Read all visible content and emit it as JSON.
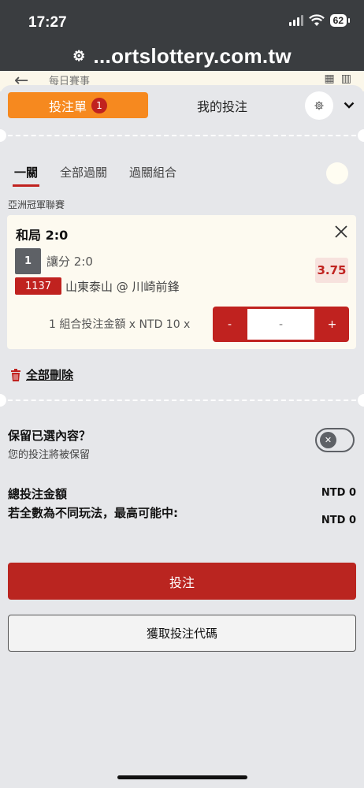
{
  "status": {
    "time": "17:27",
    "battery": "62"
  },
  "browser": {
    "url": "...ortslottery.com.tw"
  },
  "peek": {
    "back": "←",
    "title": "每日賽事"
  },
  "header": {
    "betslip_label": "投注單",
    "betslip_count": "1",
    "mybets_label": "我的投注"
  },
  "subtabs": [
    "一關",
    "全部過關",
    "過關組合"
  ],
  "league": "亞洲冠軍聯賽",
  "bet": {
    "market": "和局 2:0",
    "selection_no": "1",
    "selection_label": "讓分 2:0",
    "odds": "3.75",
    "match_code": "1137",
    "match_name": "山東泰山 @ 川崎前鋒",
    "stake_label": "1 組合投注金額 x NTD 10 x",
    "stepper_minus": "-",
    "stepper_plus": "+",
    "stake_placeholder": "-"
  },
  "delete_all": "全部刪除",
  "keep": {
    "title": "保留已選內容？",
    "subtitle": "您的投注將被保留",
    "toggle_on": false
  },
  "totals": {
    "total_label": "總投注金額",
    "total_value": "NTD 0",
    "max_label": "若全數為不同玩法，最高可能中:",
    "max_value": "NTD 0"
  },
  "buttons": {
    "place_bet": "投注",
    "get_code": "獲取投注代碼"
  },
  "colors": {
    "accent_orange": "#f6891f",
    "accent_red": "#c0221f",
    "background": "#e6e7ea"
  }
}
